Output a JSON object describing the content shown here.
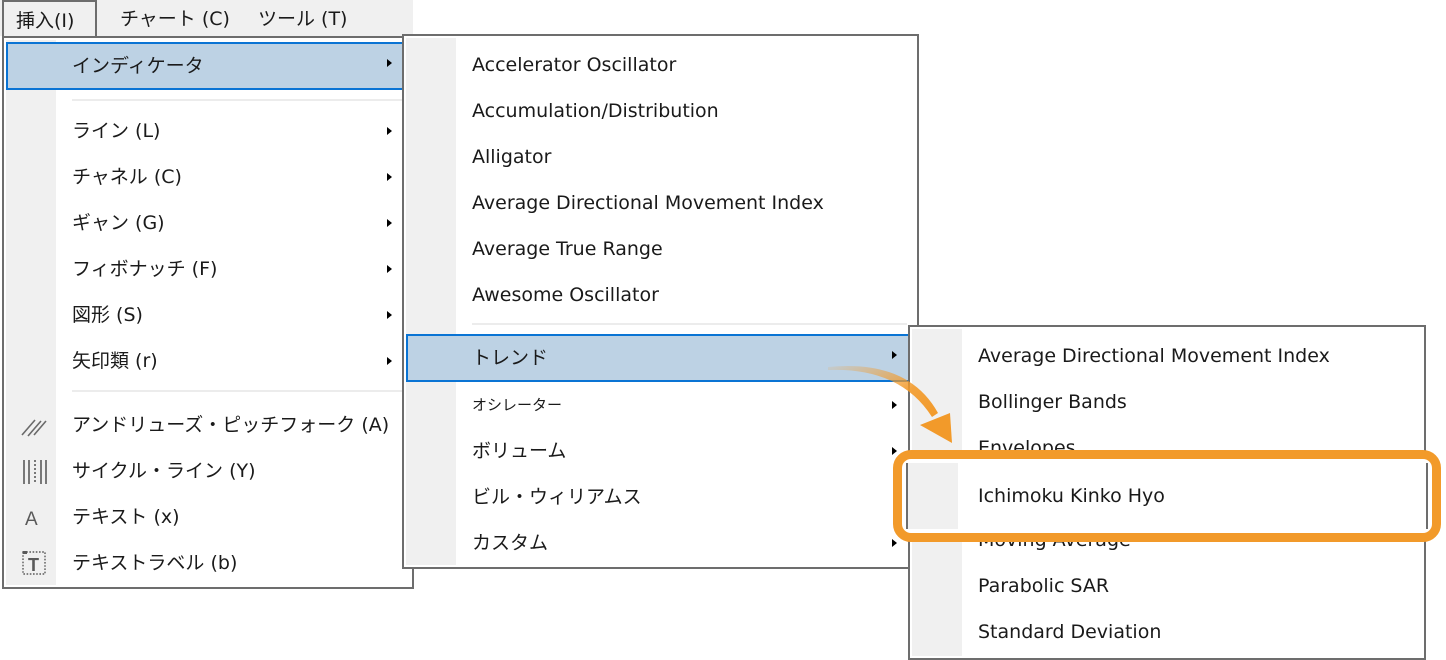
{
  "menubar": {
    "items": [
      {
        "label": "挿入(I)",
        "open": true
      },
      {
        "label": "チャート (C)"
      },
      {
        "label": "ツール (T)"
      }
    ]
  },
  "insert_menu": {
    "items": [
      {
        "label": "インディケータ",
        "submenu": true,
        "highlighted": true
      },
      {
        "label": "ライン (L)",
        "submenu": true
      },
      {
        "label": "チャネル (C)",
        "submenu": true
      },
      {
        "label": "ギャン (G)",
        "submenu": true
      },
      {
        "label": "フィボナッチ (F)",
        "submenu": true
      },
      {
        "label": "図形 (S)",
        "submenu": true
      },
      {
        "label": "矢印類 (r)",
        "submenu": true
      },
      {
        "label": "アンドリューズ・ピッチフォーク (A)",
        "icon": "pitchfork-icon"
      },
      {
        "label": "サイクル・ライン (Y)",
        "icon": "cycle-lines-icon"
      },
      {
        "label": "テキスト (x)",
        "icon": "text-icon"
      },
      {
        "label": "テキストラベル (b)",
        "icon": "text-label-icon"
      }
    ]
  },
  "indicators_menu": {
    "items": [
      {
        "label": "Accelerator Oscillator"
      },
      {
        "label": "Accumulation/Distribution"
      },
      {
        "label": "Alligator"
      },
      {
        "label": "Average Directional Movement Index"
      },
      {
        "label": "Average True Range"
      },
      {
        "label": "Awesome Oscillator"
      },
      {
        "label": "トレンド",
        "submenu": true,
        "highlighted": true
      },
      {
        "label": "オシレーター",
        "submenu": true
      },
      {
        "label": "ボリューム",
        "submenu": true
      },
      {
        "label": "ビル・ウィリアムス",
        "submenu": true
      },
      {
        "label": "カスタム",
        "submenu": true
      }
    ]
  },
  "trend_menu": {
    "items": [
      {
        "label": "Average Directional Movement Index"
      },
      {
        "label": "Bollinger Bands"
      },
      {
        "label": "Envelopes"
      },
      {
        "label": "Ichimoku Kinko Hyo",
        "callout": true
      },
      {
        "label": "Moving Average"
      },
      {
        "label": "Parabolic SAR"
      },
      {
        "label": "Standard Deviation"
      }
    ]
  },
  "annotation": {
    "callout_color": "#f29a2a",
    "highlight_color": "#bdd2e4",
    "highlight_border": "#0a74d4"
  }
}
